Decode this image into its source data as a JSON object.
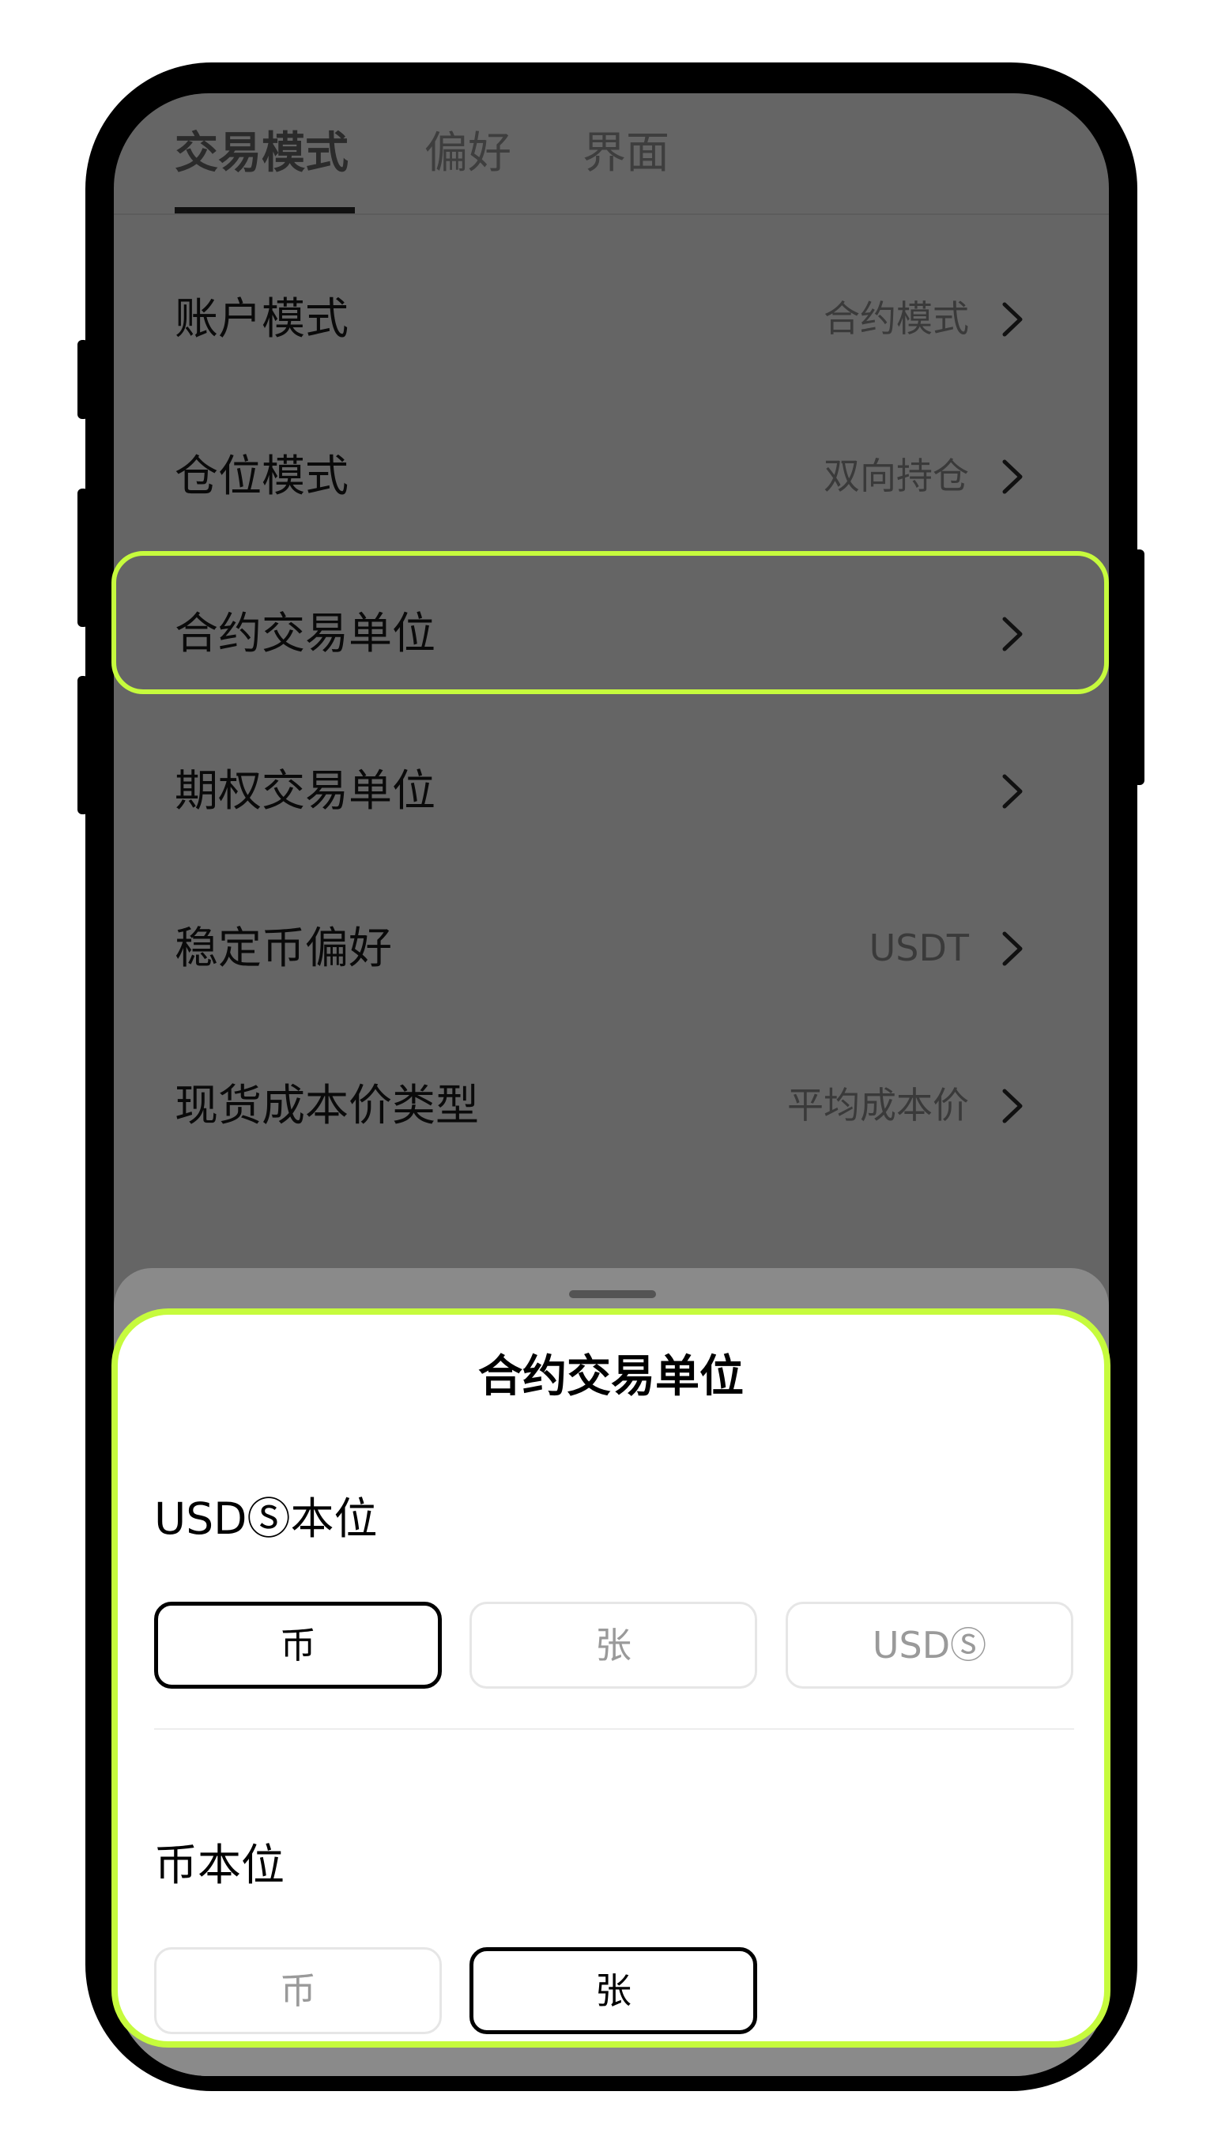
{
  "tabs": [
    {
      "label": "交易模式",
      "active": true
    },
    {
      "label": "偏好",
      "active": false
    },
    {
      "label": "界面",
      "active": false
    }
  ],
  "settings": [
    {
      "label": "账户模式",
      "value": "合约模式"
    },
    {
      "label": "仓位模式",
      "value": "双向持仓"
    },
    {
      "label": "合约交易单位",
      "value": ""
    },
    {
      "label": "期权交易单位",
      "value": ""
    },
    {
      "label": "稳定币偏好",
      "value": "USDT"
    },
    {
      "label": "现货成本价类型",
      "value": "平均成本价"
    }
  ],
  "sheet": {
    "title": "合约交易单位",
    "sections": [
      {
        "title": "USDⓈ本位",
        "options": [
          {
            "label": "币",
            "selected": true
          },
          {
            "label": "张",
            "selected": false
          },
          {
            "label": "USDⓈ",
            "selected": false
          }
        ]
      },
      {
        "title": "币本位",
        "options": [
          {
            "label": "币",
            "selected": false
          },
          {
            "label": "张",
            "selected": true
          }
        ]
      }
    ]
  },
  "colors": {
    "highlight": "#c6fb3d",
    "overlay": "#656565",
    "selected_border": "#000000"
  }
}
